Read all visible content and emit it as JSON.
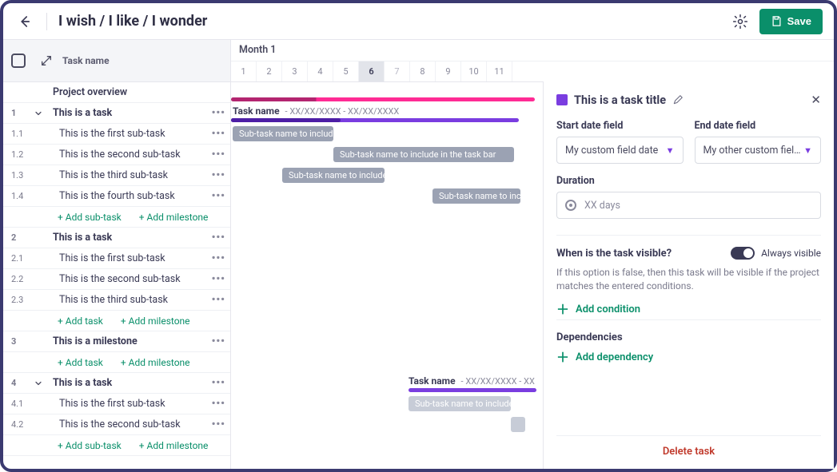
{
  "header": {
    "title": "I wish / I like / I wonder",
    "save_label": "Save"
  },
  "columns": {
    "task_name": "Task name"
  },
  "timeline": {
    "month_label": "Month 1",
    "days": [
      "1",
      "2",
      "3",
      "4",
      "5",
      "6",
      "7",
      "8",
      "9",
      "10",
      "11"
    ],
    "selected_day_index": 5,
    "dim_day_index": 6
  },
  "rows": {
    "overview": "Project overview",
    "g1": {
      "num": "1",
      "label": "This is a task"
    },
    "g1_summary": {
      "task_name_label": "Task name",
      "dates": "- XX/XX/XXXX - XX/XX/XXXX"
    },
    "g1s1": {
      "num": "1.1",
      "label": "This is the first sub-task",
      "bar": "Sub-task name to include…"
    },
    "g1s2": {
      "num": "1.2",
      "label": "This is the second sub-task",
      "bar": "Sub-task name to include in the task bar"
    },
    "g1s3": {
      "num": "1.3",
      "label": "This is the third sub-task",
      "bar": "Sub-task name to include…"
    },
    "g1s4": {
      "num": "1.4",
      "label": "This is the fourth sub-task",
      "bar": "Sub-task name to include"
    },
    "add_subtask": "+ Add sub-task",
    "add_milestone": "+ Add milestone",
    "add_task": "+ Add task",
    "g2": {
      "num": "2",
      "label": "This is a task"
    },
    "g2s1": {
      "num": "2.1",
      "label": "This is the first sub-task"
    },
    "g2s2": {
      "num": "2.2",
      "label": "This is the second sub-task"
    },
    "g2s3": {
      "num": "2.3",
      "label": "This is the third sub-task"
    },
    "g3": {
      "num": "3",
      "label": "This is a milestone"
    },
    "g4": {
      "num": "4",
      "label": "This is a task"
    },
    "g4_summary": {
      "task_name_label": "Task name",
      "dates": "- XX/XX/XXXX - XX"
    },
    "g4s1": {
      "num": "4.1",
      "label": "This is the first sub-task",
      "bar": "Sub-task name to include…"
    },
    "g4s2": {
      "num": "4.2",
      "label": "This is the second sub-task"
    }
  },
  "panel": {
    "title": "This is a task title",
    "start_label": "Start date field",
    "start_value": "My custom field date",
    "end_label": "End date field",
    "end_value": "My other custom fiel…",
    "duration_label": "Duration",
    "duration_value": "XX days",
    "visible_label": "When is the task visible?",
    "always_visible": "Always visible",
    "visible_desc": "If this option is false, then this task will be visible if the project matches the entered conditions.",
    "add_condition": "Add condition",
    "dependencies_label": "Dependencies",
    "add_dependency": "Add dependency",
    "delete_label": "Delete task"
  }
}
